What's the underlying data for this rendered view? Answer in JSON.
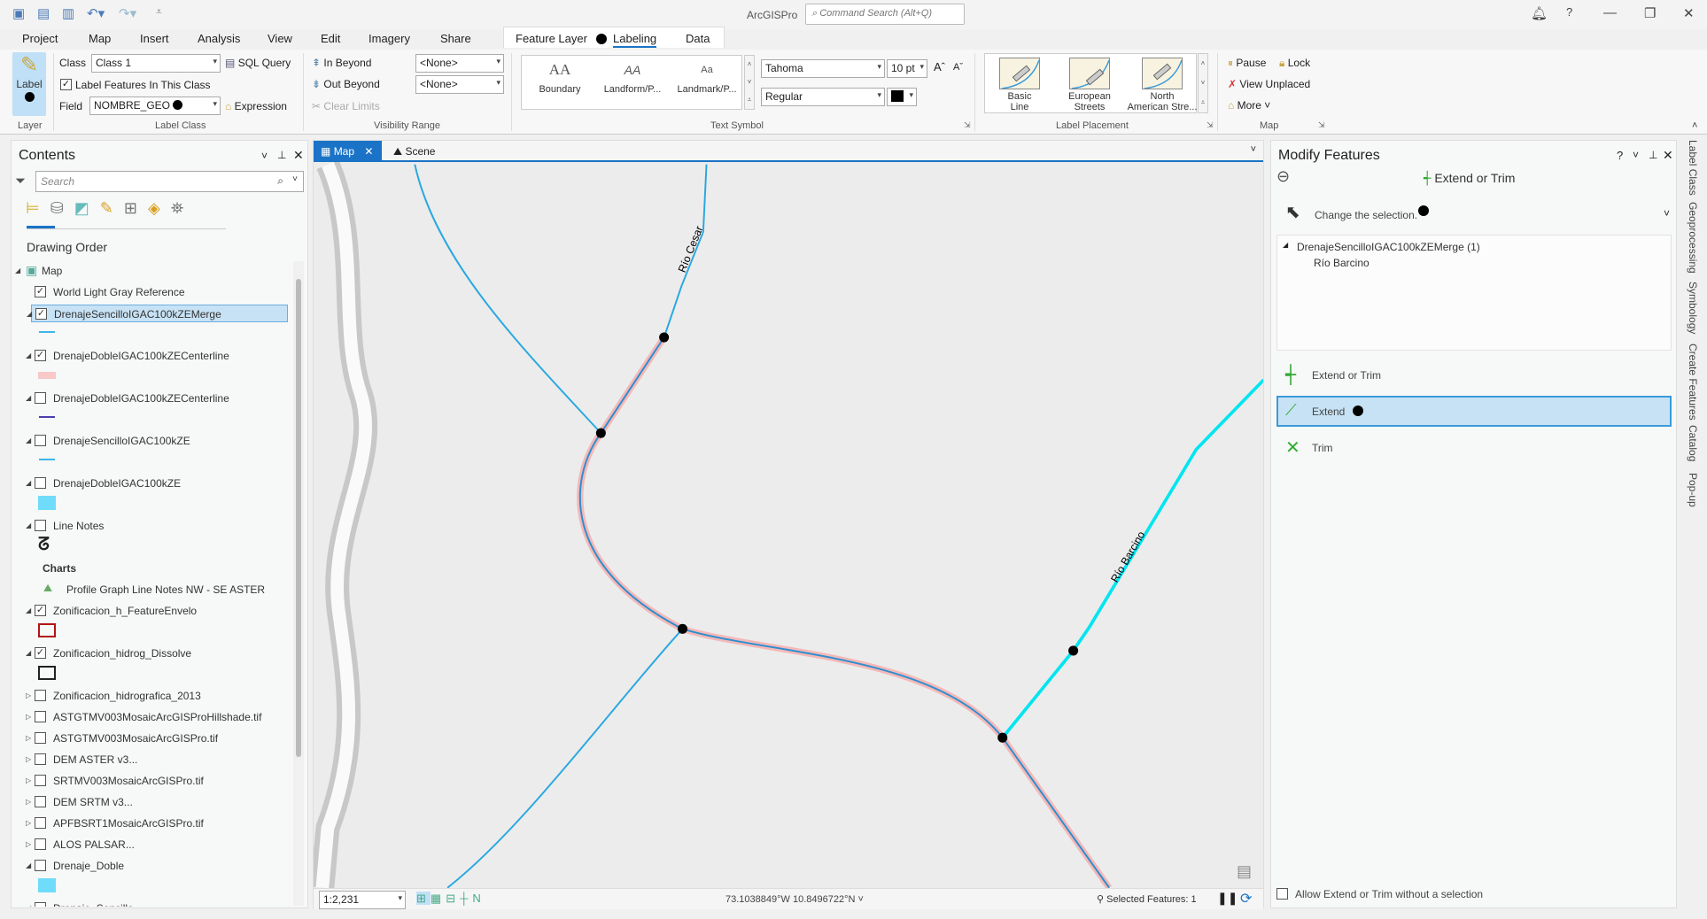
{
  "app": {
    "title": "ArcGISPro",
    "command_search_placeholder": "Command Search (Alt+Q)"
  },
  "ribbon_tabs": [
    "Project",
    "Map",
    "Insert",
    "Analysis",
    "View",
    "Edit",
    "Imagery",
    "Share"
  ],
  "context_tabs": {
    "feature_layer": "Feature Layer",
    "labeling": "Labeling",
    "data": "Data",
    "active": "Labeling"
  },
  "ribbon": {
    "layer": {
      "label_button": "Label",
      "group": "Layer"
    },
    "label_class": {
      "class_label": "Class",
      "class_value": "Class 1",
      "sql_query": "SQL Query",
      "label_features": "Label Features In This Class",
      "label_features_checked": true,
      "field_label": "Field",
      "field_value": "NOMBRE_GEO",
      "expression": "Expression",
      "group": "Label Class"
    },
    "visibility": {
      "in_beyond": "In Beyond",
      "out_beyond": "Out Beyond",
      "clear_limits": "Clear Limits",
      "in_value": "<None>",
      "out_value": "<None>",
      "group": "Visibility Range"
    },
    "text_symbol": {
      "styles": [
        {
          "glyph": "AA",
          "label": "Boundary"
        },
        {
          "glyph": "AA",
          "label": "Landform/P..."
        },
        {
          "glyph": "Aa",
          "label": "Landmark/P..."
        }
      ],
      "font": "Tahoma",
      "size": "10 pt",
      "style": "Regular",
      "color": "#000000",
      "group": "Text Symbol"
    },
    "label_placement": {
      "items": [
        {
          "l1": "Basic",
          "l2": "Line"
        },
        {
          "l1": "European",
          "l2": "Streets"
        },
        {
          "l1": "North",
          "l2": "American Stre..."
        }
      ],
      "group": "Label Placement"
    },
    "map": {
      "pause": "Pause",
      "lock": "Lock",
      "view_unplaced": "View Unplaced",
      "more": "More",
      "group": "Map"
    }
  },
  "contents": {
    "title": "Contents",
    "search_placeholder": "Search",
    "heading": "Drawing Order",
    "layers": [
      {
        "name": "Map",
        "checkbox": null,
        "expand": "open",
        "indent": 0
      },
      {
        "name": "World Light Gray Reference",
        "checked": true,
        "expand": null
      },
      {
        "name": "DrenajeSencilloIGAC100kZEMerge",
        "checked": true,
        "expand": "open",
        "selected": true,
        "swatch": "line",
        "color": "#3fb6e8"
      },
      {
        "name": "DrenajeDobleIGAC100kZECenterline",
        "checked": true,
        "expand": "open",
        "swatch": "fill",
        "color": "#f9c8c8"
      },
      {
        "name": "DrenajeDobleIGAC100kZECenterline",
        "checked": false,
        "expand": "open",
        "swatch": "line",
        "color": "#4a3fb0"
      },
      {
        "name": "DrenajeSencilloIGAC100kZE",
        "checked": false,
        "expand": "open",
        "swatch": "line",
        "color": "#3fb6e8"
      },
      {
        "name": "DrenajeDobleIGAC100kZE",
        "checked": false,
        "expand": "open",
        "swatch": "fill",
        "color": "#6fdcfb"
      },
      {
        "name": "Line Notes",
        "checked": false,
        "expand": "open",
        "swatch": "squiggle"
      },
      {
        "name": "Charts",
        "heading": true
      },
      {
        "name": "Profile Graph Line Notes NW - SE ASTER",
        "chart": true
      },
      {
        "name": "Zonificacion_h_FeatureEnvelo",
        "checked": true,
        "expand": "open",
        "swatch": "outline",
        "color": "#b01515"
      },
      {
        "name": "Zonificacion_hidrog_Dissolve",
        "checked": true,
        "expand": "open",
        "swatch": "outline",
        "color": "#222222"
      },
      {
        "name": "Zonificacion_hidrografica_2013",
        "checked": false,
        "expand": "closed"
      },
      {
        "name": "ASTGTMV003MosaicArcGISProHillshade.tif",
        "checked": false,
        "expand": "closed"
      },
      {
        "name": "ASTGTMV003MosaicArcGISPro.tif",
        "checked": false,
        "expand": "closed"
      },
      {
        "name": "DEM ASTER v3...",
        "checked": false,
        "expand": "closed"
      },
      {
        "name": "SRTMV003MosaicArcGISPro.tif",
        "checked": false,
        "expand": "closed"
      },
      {
        "name": "DEM SRTM v3...",
        "checked": false,
        "expand": "closed"
      },
      {
        "name": "APFBSRT1MosaicArcGISPro.tif",
        "checked": false,
        "expand": "closed"
      },
      {
        "name": "ALOS PALSAR...",
        "checked": false,
        "expand": "closed"
      },
      {
        "name": "Drenaje_Doble",
        "checked": false,
        "expand": "open",
        "swatch": "fill",
        "color": "#6fdcfb"
      },
      {
        "name": "Drenaje_Sencillo",
        "checked": false,
        "expand": "open"
      }
    ]
  },
  "map_view": {
    "tabs": [
      {
        "label": "Map",
        "active": true
      },
      {
        "label": "Scene",
        "active": false
      }
    ],
    "labels": {
      "rio_cesar": "Río Cesar",
      "rio_barcino": "Río Barcino"
    },
    "scale": "1:2,231",
    "coordinates": "73.1038849°W 10.8496722°N",
    "selected_features": "Selected Features: 1",
    "colors": {
      "stream": "#29a8e0",
      "selected": "#00e5f0",
      "highlight": "#f4b8b8"
    }
  },
  "modify": {
    "title": "Modify Features",
    "tool": "Extend or Trim",
    "change_selection": "Change the selection.",
    "tree_layer": "DrenajeSencilloIGAC100kZEMerge (1)",
    "tree_feature": "Río Barcino",
    "tools": [
      {
        "label": "Extend or Trim"
      },
      {
        "label": "Extend",
        "selected": true
      },
      {
        "label": "Trim"
      }
    ],
    "allow_label": "Allow Extend or Trim without a selection",
    "allow_checked": false
  },
  "side_tabs": [
    "Label Class",
    "Geoprocessing",
    "Symbology",
    "Create Features",
    "Catalog",
    "Pop-up"
  ]
}
